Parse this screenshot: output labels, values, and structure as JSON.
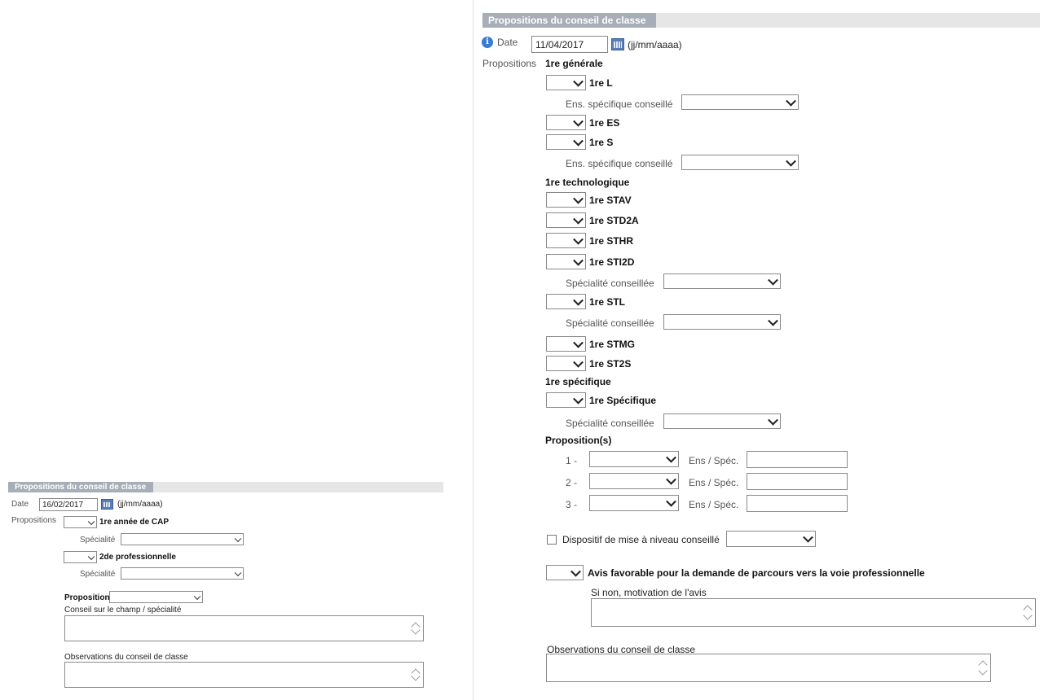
{
  "left": {
    "title": "Propositions du conseil de classe",
    "date_label": "Date",
    "date_value": "16/02/2017",
    "date_format": "(jj/mm/aaaa)",
    "propositions_label": "Propositions",
    "cap_label": "1re année de CAP",
    "specialite_label_1": "Spécialité",
    "pro_label": "2de professionnelle",
    "specialite_label_2": "Spécialité",
    "proposition_label": "Proposition",
    "conseil_label": "Conseil sur le champ / spécialité",
    "observations_label": "Observations du conseil de classe"
  },
  "right": {
    "title": "Propositions du conseil de classe",
    "date_label": "Date",
    "date_value": "11/04/2017",
    "date_format": "(jj/mm/aaaa)",
    "propositions_label": "Propositions",
    "generale_heading": "1re générale",
    "l_label": "1re L",
    "ens_label_1": "Ens. spécifique conseillé",
    "es_label": "1re ES",
    "s_label": "1re S",
    "ens_label_2": "Ens. spécifique conseillé",
    "techno_heading": "1re technologique",
    "stav_label": "1re STAV",
    "std2a_label": "1re STD2A",
    "sthr_label": "1re STHR",
    "sti2d_label": "1re STI2D",
    "spec_label_1": "Spécialité conseillée",
    "stl_label": "1re STL",
    "spec_label_2": "Spécialité conseillée",
    "stmg_label": "1re STMG",
    "st2s_label": "1re ST2S",
    "specifique_heading": "1re spécifique",
    "specifique_label": "1re Spécifique",
    "spec_label_3": "Spécialité conseillée",
    "propositions_heading": "Proposition(s)",
    "prop_rows": [
      {
        "num": "1 -",
        "ens": "Ens / Spéc."
      },
      {
        "num": "2 -",
        "ens": "Ens / Spéc."
      },
      {
        "num": "3 -",
        "ens": "Ens / Spéc."
      }
    ],
    "dispositif_label": "Dispositif de mise à niveau conseillé",
    "avis_label": "Avis favorable pour la demande de parcours vers la voie professionnelle",
    "motivation_label": "Si non, motivation de l'avis",
    "observations_label": "Observations du conseil de classe"
  },
  "icons": {
    "info": "info-icon",
    "calendar": "calendar-icon",
    "chevron": "chevron-down-icon",
    "scroll_up": "scroll-up-icon",
    "scroll_down": "scroll-down-icon"
  }
}
